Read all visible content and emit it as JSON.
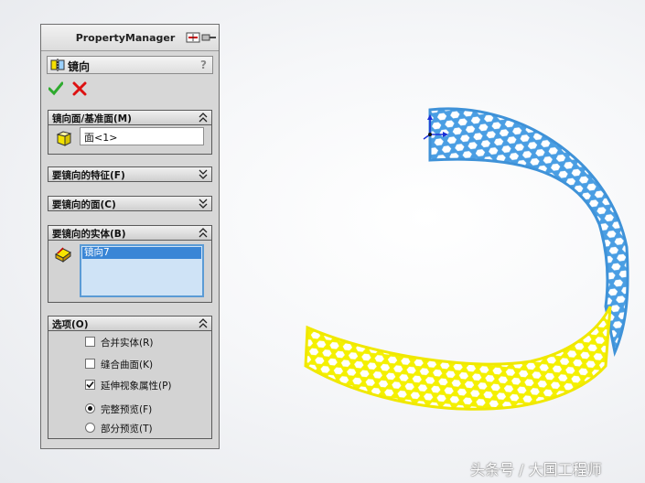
{
  "panel": {
    "title": "PropertyManager",
    "feature": {
      "title": "镜向",
      "help": "?",
      "icon": "mirror-feature-icon"
    },
    "ok_icon": "check-icon",
    "cancel_icon": "close-icon"
  },
  "groups": {
    "mirror_face": {
      "title": "镜向面/基准面(M)",
      "state": "expanded",
      "value": "面<1>"
    },
    "features": {
      "title": "要镜向的特征(F)",
      "state": "collapsed"
    },
    "faces": {
      "title": "要镜向的面(C)",
      "state": "collapsed"
    },
    "bodies": {
      "title": "要镜向的实体(B)",
      "state": "expanded",
      "items": [
        "镜向7"
      ]
    },
    "options": {
      "title": "选项(O)",
      "state": "expanded",
      "merge_solids": {
        "label": "合并实体(R)",
        "checked": false
      },
      "knit_surfaces": {
        "label": "缝合曲面(K)",
        "checked": false
      },
      "propagate_visual": {
        "label": "延伸视象属性(P)",
        "checked": true
      },
      "full_preview": {
        "label": "完整预览(F)",
        "selected": true
      },
      "partial_preview": {
        "label": "部分预览(T)",
        "selected": false
      }
    }
  },
  "watermark": "头条号 / 大国工程师",
  "colors": {
    "original_body": "#4a9ee3",
    "mirrored_body": "#f4f000",
    "selection": "#3a86d6",
    "triad_axis": "#1a2fd6"
  }
}
